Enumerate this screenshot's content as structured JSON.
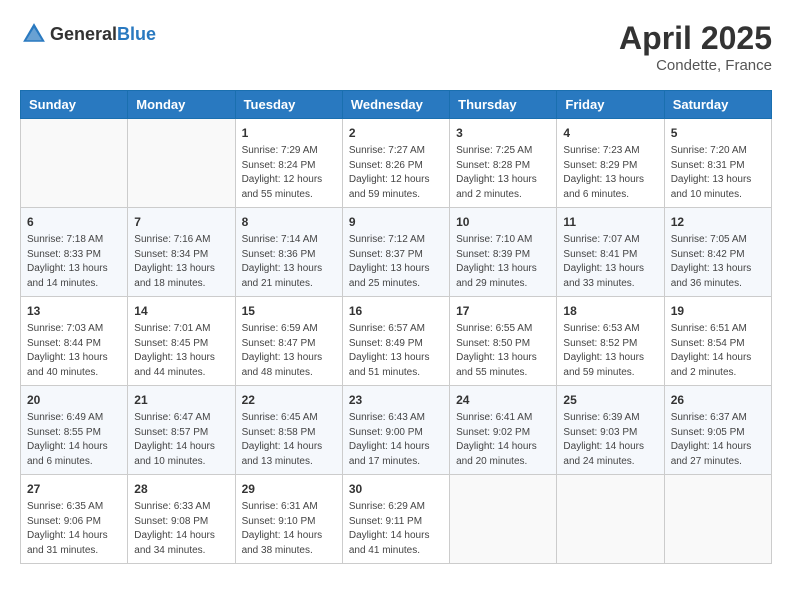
{
  "header": {
    "logo_general": "General",
    "logo_blue": "Blue",
    "month": "April 2025",
    "location": "Condette, France"
  },
  "weekdays": [
    "Sunday",
    "Monday",
    "Tuesday",
    "Wednesday",
    "Thursday",
    "Friday",
    "Saturday"
  ],
  "weeks": [
    [
      null,
      null,
      {
        "day": "1",
        "sunrise": "Sunrise: 7:29 AM",
        "sunset": "Sunset: 8:24 PM",
        "daylight": "Daylight: 12 hours and 55 minutes."
      },
      {
        "day": "2",
        "sunrise": "Sunrise: 7:27 AM",
        "sunset": "Sunset: 8:26 PM",
        "daylight": "Daylight: 12 hours and 59 minutes."
      },
      {
        "day": "3",
        "sunrise": "Sunrise: 7:25 AM",
        "sunset": "Sunset: 8:28 PM",
        "daylight": "Daylight: 13 hours and 2 minutes."
      },
      {
        "day": "4",
        "sunrise": "Sunrise: 7:23 AM",
        "sunset": "Sunset: 8:29 PM",
        "daylight": "Daylight: 13 hours and 6 minutes."
      },
      {
        "day": "5",
        "sunrise": "Sunrise: 7:20 AM",
        "sunset": "Sunset: 8:31 PM",
        "daylight": "Daylight: 13 hours and 10 minutes."
      }
    ],
    [
      {
        "day": "6",
        "sunrise": "Sunrise: 7:18 AM",
        "sunset": "Sunset: 8:33 PM",
        "daylight": "Daylight: 13 hours and 14 minutes."
      },
      {
        "day": "7",
        "sunrise": "Sunrise: 7:16 AM",
        "sunset": "Sunset: 8:34 PM",
        "daylight": "Daylight: 13 hours and 18 minutes."
      },
      {
        "day": "8",
        "sunrise": "Sunrise: 7:14 AM",
        "sunset": "Sunset: 8:36 PM",
        "daylight": "Daylight: 13 hours and 21 minutes."
      },
      {
        "day": "9",
        "sunrise": "Sunrise: 7:12 AM",
        "sunset": "Sunset: 8:37 PM",
        "daylight": "Daylight: 13 hours and 25 minutes."
      },
      {
        "day": "10",
        "sunrise": "Sunrise: 7:10 AM",
        "sunset": "Sunset: 8:39 PM",
        "daylight": "Daylight: 13 hours and 29 minutes."
      },
      {
        "day": "11",
        "sunrise": "Sunrise: 7:07 AM",
        "sunset": "Sunset: 8:41 PM",
        "daylight": "Daylight: 13 hours and 33 minutes."
      },
      {
        "day": "12",
        "sunrise": "Sunrise: 7:05 AM",
        "sunset": "Sunset: 8:42 PM",
        "daylight": "Daylight: 13 hours and 36 minutes."
      }
    ],
    [
      {
        "day": "13",
        "sunrise": "Sunrise: 7:03 AM",
        "sunset": "Sunset: 8:44 PM",
        "daylight": "Daylight: 13 hours and 40 minutes."
      },
      {
        "day": "14",
        "sunrise": "Sunrise: 7:01 AM",
        "sunset": "Sunset: 8:45 PM",
        "daylight": "Daylight: 13 hours and 44 minutes."
      },
      {
        "day": "15",
        "sunrise": "Sunrise: 6:59 AM",
        "sunset": "Sunset: 8:47 PM",
        "daylight": "Daylight: 13 hours and 48 minutes."
      },
      {
        "day": "16",
        "sunrise": "Sunrise: 6:57 AM",
        "sunset": "Sunset: 8:49 PM",
        "daylight": "Daylight: 13 hours and 51 minutes."
      },
      {
        "day": "17",
        "sunrise": "Sunrise: 6:55 AM",
        "sunset": "Sunset: 8:50 PM",
        "daylight": "Daylight: 13 hours and 55 minutes."
      },
      {
        "day": "18",
        "sunrise": "Sunrise: 6:53 AM",
        "sunset": "Sunset: 8:52 PM",
        "daylight": "Daylight: 13 hours and 59 minutes."
      },
      {
        "day": "19",
        "sunrise": "Sunrise: 6:51 AM",
        "sunset": "Sunset: 8:54 PM",
        "daylight": "Daylight: 14 hours and 2 minutes."
      }
    ],
    [
      {
        "day": "20",
        "sunrise": "Sunrise: 6:49 AM",
        "sunset": "Sunset: 8:55 PM",
        "daylight": "Daylight: 14 hours and 6 minutes."
      },
      {
        "day": "21",
        "sunrise": "Sunrise: 6:47 AM",
        "sunset": "Sunset: 8:57 PM",
        "daylight": "Daylight: 14 hours and 10 minutes."
      },
      {
        "day": "22",
        "sunrise": "Sunrise: 6:45 AM",
        "sunset": "Sunset: 8:58 PM",
        "daylight": "Daylight: 14 hours and 13 minutes."
      },
      {
        "day": "23",
        "sunrise": "Sunrise: 6:43 AM",
        "sunset": "Sunset: 9:00 PM",
        "daylight": "Daylight: 14 hours and 17 minutes."
      },
      {
        "day": "24",
        "sunrise": "Sunrise: 6:41 AM",
        "sunset": "Sunset: 9:02 PM",
        "daylight": "Daylight: 14 hours and 20 minutes."
      },
      {
        "day": "25",
        "sunrise": "Sunrise: 6:39 AM",
        "sunset": "Sunset: 9:03 PM",
        "daylight": "Daylight: 14 hours and 24 minutes."
      },
      {
        "day": "26",
        "sunrise": "Sunrise: 6:37 AM",
        "sunset": "Sunset: 9:05 PM",
        "daylight": "Daylight: 14 hours and 27 minutes."
      }
    ],
    [
      {
        "day": "27",
        "sunrise": "Sunrise: 6:35 AM",
        "sunset": "Sunset: 9:06 PM",
        "daylight": "Daylight: 14 hours and 31 minutes."
      },
      {
        "day": "28",
        "sunrise": "Sunrise: 6:33 AM",
        "sunset": "Sunset: 9:08 PM",
        "daylight": "Daylight: 14 hours and 34 minutes."
      },
      {
        "day": "29",
        "sunrise": "Sunrise: 6:31 AM",
        "sunset": "Sunset: 9:10 PM",
        "daylight": "Daylight: 14 hours and 38 minutes."
      },
      {
        "day": "30",
        "sunrise": "Sunrise: 6:29 AM",
        "sunset": "Sunset: 9:11 PM",
        "daylight": "Daylight: 14 hours and 41 minutes."
      },
      null,
      null,
      null
    ]
  ]
}
